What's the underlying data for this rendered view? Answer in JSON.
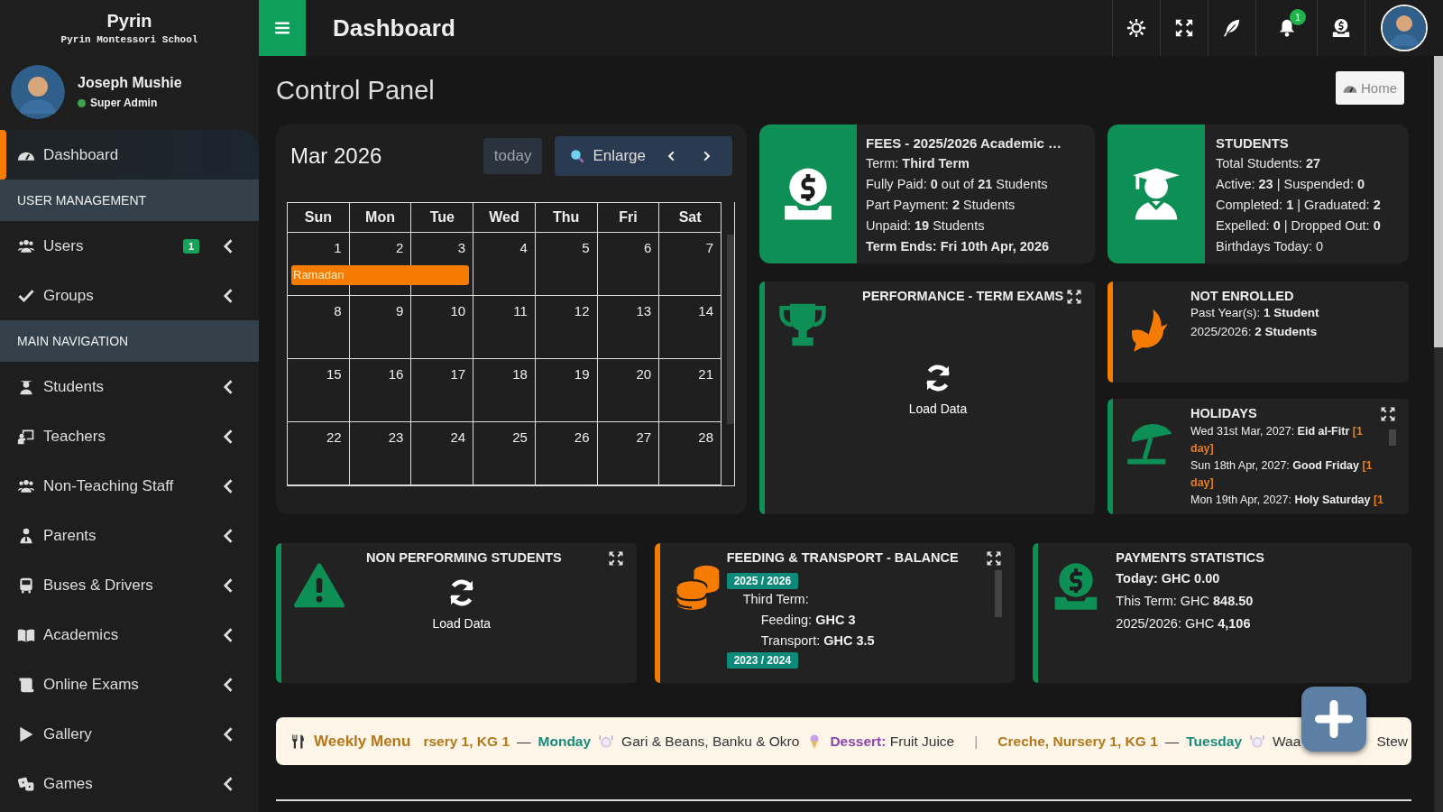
{
  "brand": {
    "name": "Pyrin",
    "school": "Pyrin Montessori School"
  },
  "user": {
    "name": "Joseph Mushie",
    "role": "Super Admin",
    "online": true
  },
  "sidebar": [
    {
      "kind": "item",
      "label": "Dashboard",
      "selected": true,
      "submenu": false
    },
    {
      "kind": "header",
      "label": "USER MANAGEMENT"
    },
    {
      "kind": "item",
      "label": "Users",
      "badge": "1",
      "selected": false,
      "submenu": true
    },
    {
      "kind": "item",
      "label": "Groups",
      "selected": false,
      "submenu": true
    },
    {
      "kind": "header",
      "label": "MAIN NAVIGATION"
    },
    {
      "kind": "item",
      "label": "Students",
      "selected": false,
      "submenu": true
    },
    {
      "kind": "item",
      "label": "Teachers",
      "selected": false,
      "submenu": true
    },
    {
      "kind": "item",
      "label": "Non-Teaching Staff",
      "selected": false,
      "submenu": true
    },
    {
      "kind": "item",
      "label": "Parents",
      "selected": false,
      "submenu": true
    },
    {
      "kind": "item",
      "label": "Buses & Drivers",
      "selected": false,
      "submenu": true
    },
    {
      "kind": "item",
      "label": "Academics",
      "selected": false,
      "submenu": true
    },
    {
      "kind": "item",
      "label": "Online Exams",
      "selected": false,
      "submenu": true
    },
    {
      "kind": "item",
      "label": "Gallery",
      "selected": false,
      "submenu": true
    },
    {
      "kind": "item",
      "label": "Games",
      "selected": false,
      "submenu": true
    }
  ],
  "topbar": {
    "title": "Dashboard",
    "notifications": "1"
  },
  "page": {
    "title": "Control Panel",
    "home": "Home"
  },
  "calendar": {
    "month": "Mar 2026",
    "today": "today",
    "enlarge": "Enlarge",
    "weekdays": [
      "Sun",
      "Mon",
      "Tue",
      "Wed",
      "Thu",
      "Fri",
      "Sat"
    ],
    "weeks": [
      {
        "events": [
          {
            "label": "Ramadan",
            "color": "#f57c00"
          }
        ],
        "days": [
          {
            "date": "1",
            "in_event": true
          },
          {
            "date": "2",
            "in_event": true
          },
          {
            "date": "3",
            "in_event": true
          },
          {
            "date": "4",
            "in_event": false
          },
          {
            "date": "5",
            "in_event": false
          },
          {
            "date": "6",
            "in_event": false
          },
          {
            "date": "7",
            "in_event": false
          }
        ]
      },
      {
        "days": [
          {
            "date": "8"
          },
          {
            "date": "9"
          },
          {
            "date": "10"
          },
          {
            "date": "11"
          },
          {
            "date": "12"
          },
          {
            "date": "13"
          },
          {
            "date": "14"
          }
        ]
      },
      {
        "days": [
          {
            "date": "15"
          },
          {
            "date": "16"
          },
          {
            "date": "17"
          },
          {
            "date": "18"
          },
          {
            "date": "19"
          },
          {
            "date": "20"
          },
          {
            "date": "21"
          }
        ]
      },
      {
        "days": [
          {
            "date": "22"
          },
          {
            "date": "23"
          },
          {
            "date": "24"
          },
          {
            "date": "25"
          },
          {
            "date": "26"
          },
          {
            "date": "27"
          },
          {
            "date": "28"
          }
        ]
      }
    ]
  },
  "fees": {
    "title": "FEES - 2025/2026 Academic …",
    "lines": [
      "Term: **Third Term**",
      "Fully Paid: **0** out of **21** Students",
      "Part Payment: **2** Students",
      "Unpaid: **19** Students"
    ],
    "footer": "Term Ends: Fri 10th Apr, 2026"
  },
  "students": {
    "title": "STUDENTS",
    "lines": [
      "Total Students: **27**",
      "Active: **23** | Suspended: **0**",
      "Completed: **1** | Graduated: **2**",
      "Expelled: **0** | Dropped Out: **0**",
      "Birthdays Today: 0"
    ]
  },
  "performance": {
    "title": "PERFORMANCE - TERM EXAMS",
    "action": "Load Data",
    "color": "#0e8f55"
  },
  "not_enrolled": {
    "title": "NOT ENROLLED",
    "lines": [
      "Past Year(s): **1 Student**",
      "2025/2026: **2 Students**"
    ],
    "color": "#f57c00"
  },
  "holidays": {
    "title": "HOLIDAYS",
    "color": "#0e8f55",
    "items": [
      {
        "date": "Wed 31st Mar, 2027:",
        "name": "Eid al-Fitr",
        "duration": "[1 day]"
      },
      {
        "date": "Sun 18th Apr, 2027:",
        "name": "Good Friday",
        "duration": "[1 day]"
      },
      {
        "date": "Mon 19th Apr, 2027:",
        "name": "Holy Saturday",
        "duration": "[1"
      }
    ]
  },
  "non_performing": {
    "title": "NON PERFORMING STUDENTS",
    "action": "Load Data",
    "color": "#0e8f55"
  },
  "feeding": {
    "title": "FEEDING & TRANSPORT - BALANCE",
    "color": "#f57c00",
    "years": [
      {
        "year": "2025 / 2026",
        "term": "Third Term:",
        "lines": [
          "Feeding: **GHC 3**",
          "Transport: **GHC 3.5**"
        ]
      },
      {
        "year": "2023 / 2024"
      }
    ]
  },
  "payments": {
    "title": "PAYMENTS STATISTICS",
    "color": "#0e8f55",
    "headline": "Today: GHC 0.00",
    "lines": [
      "This Term: GHC **848.50**",
      "2025/2026: GHC **4,106**"
    ]
  },
  "weekly_menu": {
    "title": "Weekly Menu",
    "divider": "|",
    "entries": [
      {
        "classes": "rsery 1, KG 1",
        "dash": "—",
        "day": "Monday",
        "dishes": "Gari & Beans, Banku & Okro",
        "dessert_label": "Dessert:",
        "dessert": "Fruit Juice"
      },
      {
        "classes": "Creche, Nursery 1, KG 1",
        "dash": "—",
        "day": "Tuesday",
        "dishes": "Waa",
        "dishes_end": "Stew"
      }
    ]
  }
}
